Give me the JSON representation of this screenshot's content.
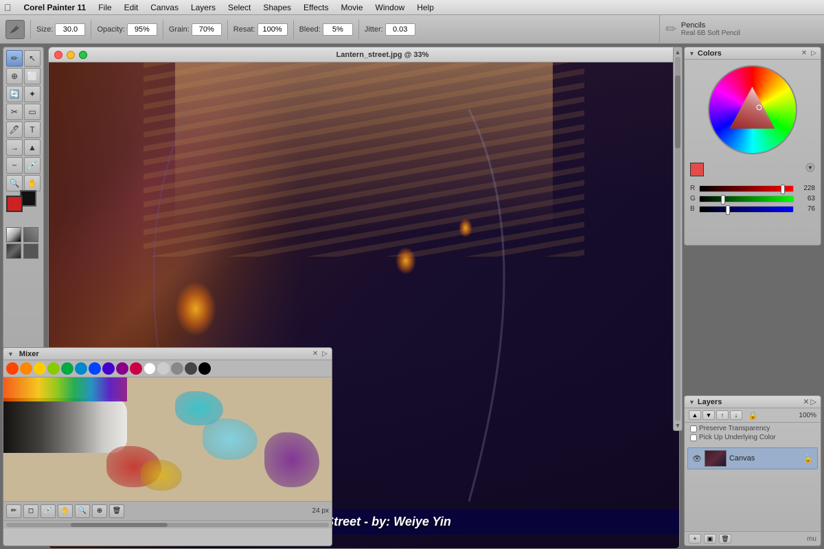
{
  "app": {
    "title": "Corel Painter 11",
    "apple_menu": "🍎"
  },
  "menu": {
    "items": [
      "File",
      "Edit",
      "Canvas",
      "Layers",
      "Select",
      "Shapes",
      "Effects",
      "Movie",
      "Window",
      "Help"
    ]
  },
  "toolbar": {
    "brush_size_label": "Size:",
    "brush_size_value": "30.0",
    "opacity_label": "Opacity:",
    "opacity_value": "95%",
    "grain_label": "Grain:",
    "grain_value": "70%",
    "resat_label": "Resat:",
    "resat_value": "100%",
    "bleed_label": "Bleed:",
    "bleed_value": "5%",
    "jitter_label": "Jitter:",
    "jitter_value": "0.03"
  },
  "brush_preset": {
    "category": "Pencils",
    "name": "Real 6B Soft Pencil"
  },
  "canvas": {
    "title": "Lantern_street.jpg @ 33%",
    "caption": "Lantern Street - by: Weiye Yin"
  },
  "colors_panel": {
    "title": "Colors",
    "r_value": "228",
    "g_value": "63",
    "b_value": "76",
    "r_thumb_pct": 89,
    "g_thumb_pct": 25,
    "b_thumb_pct": 30
  },
  "layers_panel": {
    "title": "Layers",
    "opacity_label": "100%",
    "preserve_transparency": "Preserve Transparency",
    "pick_up_color": "Pick Up Underlying Color",
    "layer_name": "Canvas"
  },
  "mixer_panel": {
    "title": "Mixer",
    "size_label": "24 px",
    "colors": [
      "#ff4400",
      "#ff8800",
      "#ffcc00",
      "#88cc00",
      "#00aa44",
      "#0088cc",
      "#0044ff",
      "#4400cc",
      "#880088",
      "#cc0044",
      "#ffffff",
      "#cccccc",
      "#888888",
      "#444444",
      "#000000"
    ]
  }
}
